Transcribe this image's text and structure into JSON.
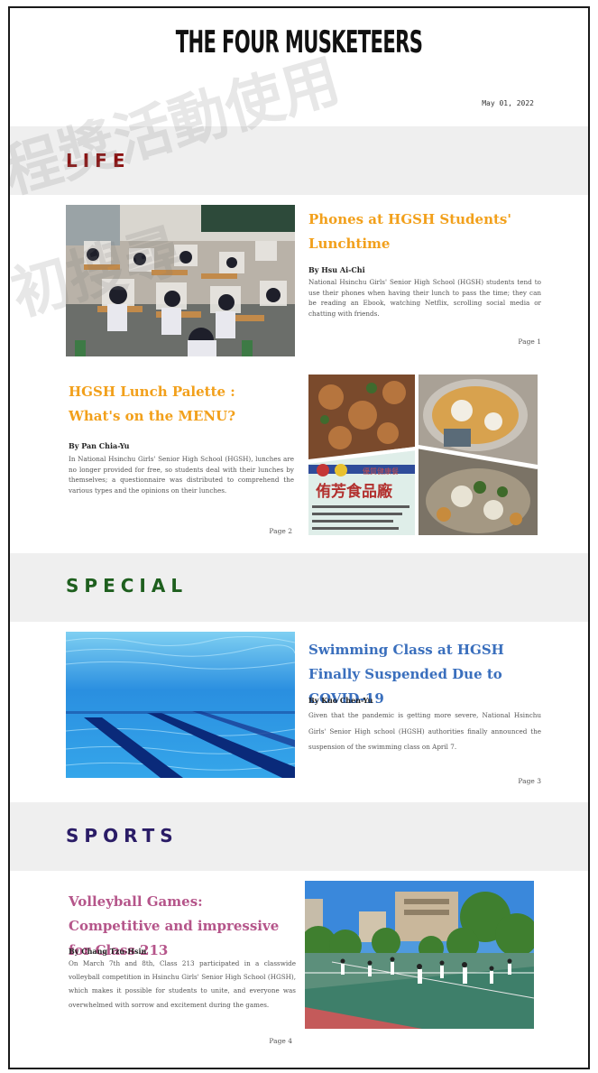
{
  "masthead": {
    "title": "THE FOUR MUSKETEERS",
    "date": "May 01, 2022"
  },
  "watermark": {
    "line1": "程獎活動使用",
    "line2": "初搜尋"
  },
  "colors": {
    "life": "#8b0f0f",
    "special": "#1e5f1e",
    "sports": "#2a1c66",
    "orange": "#f2a01b",
    "blue": "#3a6fbd",
    "pink": "#b5558a"
  },
  "sections": [
    {
      "title": "LIFE"
    },
    {
      "title": "SPECIAL"
    },
    {
      "title": "SPORTS"
    }
  ],
  "articles": [
    {
      "headline": "Phones at HGSH Students' Lunchtime",
      "byline": "By Hsu Ai-Chi",
      "summary": "National Hsinchu Girls' Senior High School (HGSH) students tend to use their phones when having their lunch to pass the time; they can be reading an Ebook, watching Netflix, scrolling social media or chatting with friends.",
      "page": "Page 1",
      "image": "classroom-lunch-icon"
    },
    {
      "headline_line1": "HGSH Lunch Palette :",
      "headline_line2": "What's on the MENU?",
      "byline": "By Pan Chia-Yu",
      "summary": "In National Hsinchu Girls' Senior High School (HGSH), lunches are no longer provided for free, so students deal with their lunches by themselves; a questionnaire was distributed to comprehend the various types and the opinions on their lunches.",
      "page": "Page 2",
      "image": "lunchbox-collage-icon",
      "sign_text": "侑芳食品廠",
      "sign_small": "優質健康餐"
    },
    {
      "headline": "Swimming Class at HGSH Finally Suspended Due to COVID-19",
      "byline": "By Kuo Chen-Yu",
      "summary": "Given that the pandemic is getting more severe, National Hsinchu Girls' Senior High school (HGSH) authorities finally announced the suspension of the swimming class on April 7.",
      "page": "Page 3",
      "image": "swimming-pool-icon"
    },
    {
      "headline": "Volleyball Games: Competitive and impressive for Class 213",
      "byline": "By Chang Tzu-Hsin",
      "summary": "On March 7th and 8th, Class 213 participated in a classwide volleyball competition in Hsinchu Girls' Senior High School (HGSH), which makes it possible for students to unite, and everyone was overwhelmed with sorrow and excitement during the games.",
      "page": "Page 4",
      "image": "volleyball-court-icon"
    }
  ]
}
